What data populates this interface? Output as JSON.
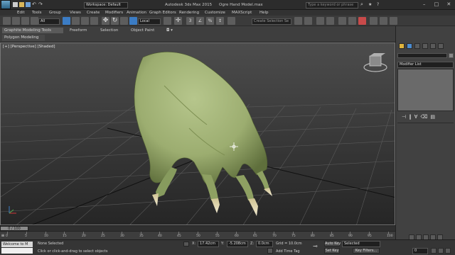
{
  "titlebar": {
    "workspace_label": "Workspace: Default",
    "app_title": "Autodesk 3ds Max 2015",
    "file_name": "Ogre Hand Model.max",
    "search_placeholder": "Type a keyword or phrase"
  },
  "menu": [
    "Edit",
    "Tools",
    "Group",
    "Views",
    "Create",
    "Modifiers",
    "Animation",
    "Graph Editors",
    "Rendering",
    "Customize",
    "MAXScript",
    "Help"
  ],
  "toolbar": {
    "selection_filter": "All",
    "reference_coord": "Local",
    "named_selection": "Create Selection Se"
  },
  "ribbon": {
    "tabs": [
      "Graphite Modeling Tools",
      "Freeform",
      "Selection",
      "Object Paint"
    ],
    "panel_label": "Polygon Modeling"
  },
  "viewport": {
    "label": "[+] [Perspective] [Shaded]"
  },
  "command_panel": {
    "modifier_list_label": "Modifier List"
  },
  "timeline": {
    "frame_readout": "0 / 100",
    "ticks": [
      "0",
      "5",
      "10",
      "15",
      "20",
      "25",
      "30",
      "35",
      "40",
      "45",
      "50",
      "55",
      "60",
      "65",
      "70",
      "75",
      "80",
      "85",
      "90",
      "95",
      "100"
    ]
  },
  "status": {
    "welcome_label": "Welcome to M",
    "selection_status": "None Selected",
    "prompt": "Click or click-and-drag to select objects",
    "x_label": "X:",
    "x_value": "17.42cm",
    "y_label": "Y:",
    "y_value": "-5.208cm",
    "z_label": "Z:",
    "z_value": "0.0cm",
    "grid": "Grid = 10.0cm",
    "auto_key": "Auto Key",
    "auto_key_mode": "Selected",
    "set_key": "Set Key",
    "key_filters": "Key Filters...",
    "add_time_tag": "Add Time Tag",
    "frame_number": "0"
  },
  "colors": {
    "ogre_skin": "#9cad70",
    "ogre_shadow": "#5f6f3c",
    "claw": "#e8ddb0",
    "viewport_border": "#777777",
    "accent_blue": "#3b7cc4",
    "axis_red": "#d03838",
    "axis_green": "#4ea84e"
  }
}
